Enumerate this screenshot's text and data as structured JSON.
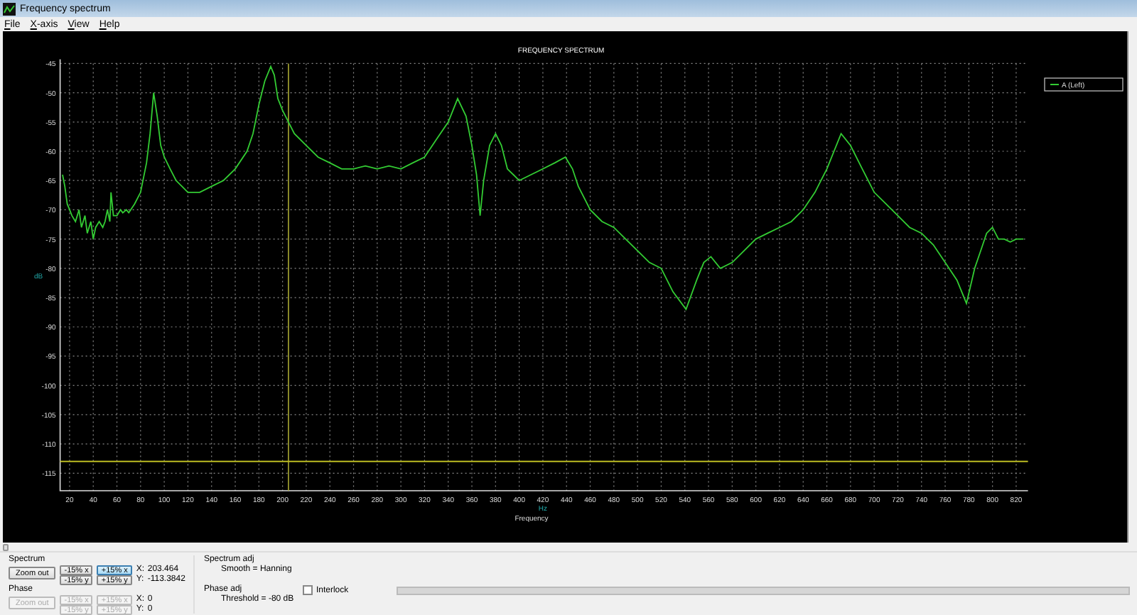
{
  "window": {
    "title": "Frequency spectrum"
  },
  "menu": [
    {
      "label": "File"
    },
    {
      "label": "X-axis"
    },
    {
      "label": "View"
    },
    {
      "label": "Help"
    }
  ],
  "chart": {
    "x_unit": "Hz",
    "chart_data": {
      "type": "line",
      "grid": true,
      "title": "FREQUENCY SPECTRUM",
      "xlabel": "Frequency",
      "ylabel": "dB",
      "xlim": [
        12,
        830
      ],
      "ylim": [
        -118,
        -45
      ],
      "xticks": [
        20,
        40,
        60,
        80,
        100,
        120,
        140,
        160,
        180,
        200,
        220,
        240,
        260,
        280,
        300,
        320,
        340,
        360,
        380,
        400,
        420,
        440,
        460,
        480,
        500,
        520,
        540,
        560,
        580,
        600,
        620,
        640,
        660,
        680,
        700,
        720,
        740,
        760,
        780,
        800,
        820
      ],
      "yticks": [
        -45,
        -50,
        -55,
        -60,
        -65,
        -70,
        -75,
        -80,
        -85,
        -90,
        -95,
        -100,
        -105,
        -110,
        -115
      ],
      "x": [
        14,
        16,
        18,
        20,
        22,
        25,
        28,
        30,
        33,
        35,
        38,
        40,
        42,
        45,
        48,
        50,
        52,
        54,
        55,
        57,
        60,
        63,
        65,
        68,
        70,
        75,
        80,
        85,
        88,
        91,
        94,
        97,
        100,
        105,
        110,
        115,
        120,
        130,
        140,
        150,
        160,
        170,
        175,
        180,
        185,
        190,
        193,
        196,
        200,
        210,
        220,
        230,
        240,
        250,
        260,
        270,
        280,
        290,
        300,
        310,
        320,
        330,
        340,
        348,
        355,
        360,
        364,
        367,
        370,
        375,
        380,
        385,
        390,
        395,
        400,
        410,
        420,
        430,
        439,
        445,
        450,
        460,
        470,
        480,
        490,
        500,
        510,
        520,
        530,
        541,
        550,
        556,
        562,
        570,
        580,
        590,
        600,
        610,
        620,
        630,
        640,
        650,
        660,
        672,
        680,
        690,
        700,
        710,
        720,
        730,
        740,
        750,
        760,
        770,
        778,
        785,
        790,
        795,
        800,
        805,
        810,
        815,
        820,
        826
      ],
      "series": [
        {
          "name": "A (Left)",
          "color": "#33cc33",
          "values": [
            -64,
            -66,
            -69,
            -70,
            -71,
            -72,
            -70,
            -73,
            -71,
            -74,
            -72,
            -75,
            -73,
            -72,
            -73,
            -72,
            -70,
            -72,
            -67,
            -71,
            -71,
            -70,
            -70.5,
            -70,
            -70.5,
            -69,
            -67,
            -62,
            -57,
            -50,
            -54,
            -59,
            -61,
            -63,
            -65,
            -66,
            -67,
            -67,
            -66,
            -65,
            -63,
            -60,
            -57,
            -52,
            -48,
            -45.5,
            -47,
            -51,
            -53,
            -57,
            -59,
            -61,
            -62,
            -63,
            -63,
            -62.5,
            -63,
            -62.5,
            -63,
            -62,
            -61,
            -58,
            -55,
            -51,
            -54,
            -59,
            -64,
            -71,
            -65,
            -59,
            -57,
            -59,
            -63,
            -64,
            -65,
            -64,
            -63,
            -62,
            -61,
            -63,
            -66,
            -70,
            -72,
            -73,
            -75,
            -77,
            -79,
            -80,
            -84,
            -87,
            -82,
            -79,
            -78,
            -80,
            -79,
            -77,
            -75,
            -74,
            -73,
            -72,
            -70,
            -67,
            -63,
            -57,
            -59,
            -63,
            -67,
            -69,
            -71,
            -73,
            -74,
            -76,
            -79,
            -82,
            -86,
            -80,
            -77,
            -74,
            -73,
            -75,
            -75,
            -75.5,
            -75,
            -75
          ]
        }
      ],
      "ref_lines": [
        {
          "axis": "x",
          "value": 205
        },
        {
          "axis": "y",
          "value": -113
        }
      ]
    }
  },
  "spectrum": {
    "title": "Spectrum",
    "zoom_out": {
      "label": "Zoom out",
      "disabled": false
    },
    "buttons": [
      {
        "label": "-15% x",
        "selected": false,
        "disabled": false
      },
      {
        "label": "+15% x",
        "selected": true,
        "disabled": false
      },
      {
        "label": "-15% y",
        "selected": false,
        "disabled": false
      },
      {
        "label": "+15% y",
        "selected": false,
        "disabled": false
      }
    ],
    "x_label": "X:",
    "x_value": "203.464",
    "y_label": "Y:",
    "y_value": "-113.3842"
  },
  "phase": {
    "title": "Phase",
    "zoom_out": {
      "label": "Zoom out",
      "disabled": true
    },
    "buttons": [
      {
        "label": "-15% x",
        "selected": false,
        "disabled": true
      },
      {
        "label": "+15% x",
        "selected": false,
        "disabled": true
      },
      {
        "label": "-15% y",
        "selected": false,
        "disabled": true
      },
      {
        "label": "+15% y",
        "selected": false,
        "disabled": true
      }
    ],
    "x_label": "X:",
    "x_value": "0",
    "y_label": "Y:",
    "y_value": "0"
  },
  "spectrum_adj": {
    "title": "Spectrum adj",
    "value": "Smooth = Hanning"
  },
  "phase_adj": {
    "title": "Phase adj",
    "value": "Threshold = -80 dB"
  },
  "interlock": {
    "label": "Interlock",
    "checked": false
  },
  "progress": {
    "level": 0
  }
}
